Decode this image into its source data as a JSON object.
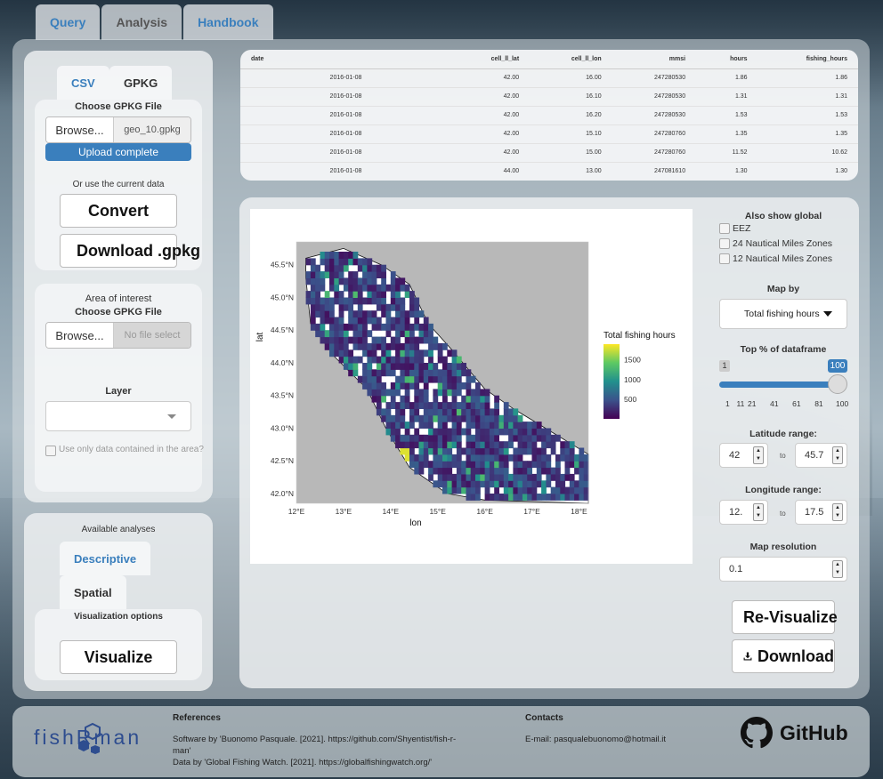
{
  "tabs": [
    {
      "label": "Query"
    },
    {
      "label": "Analysis"
    },
    {
      "label": "Handbook"
    }
  ],
  "upload": {
    "tab_csv": "CSV",
    "tab_gpkg": "GPKG",
    "choose_label": "Choose GPKG File",
    "browse_label": "Browse...",
    "file_name": "geo_10.gpkg",
    "progress_text": "Upload complete",
    "progress": 1.0,
    "current_data_label": "Or use the current data",
    "convert_label": "Convert",
    "download_label": "Download .gpkg"
  },
  "area": {
    "title": "Area of interest",
    "choose_label": "Choose GPKG File",
    "browse_label": "Browse...",
    "placeholder": "No file select",
    "layer_label": "Layer",
    "layer_value": "",
    "checkbox_label": "Use only data contained in the area?"
  },
  "analyses": {
    "title": "Available analyses",
    "descriptive": "Descriptive",
    "spatial": "Spatial",
    "viz_options": "Visualization options",
    "visualize_label": "Visualize"
  },
  "table": {
    "columns": [
      "date",
      "cell_ll_lat",
      "cell_ll_lon",
      "mmsi",
      "hours",
      "fishing_hours"
    ],
    "rows": [
      [
        "2016-01-08",
        "42.00",
        "16.00",
        "247280530",
        "1.86",
        "1.86"
      ],
      [
        "2016-01-08",
        "42.00",
        "16.10",
        "247280530",
        "1.31",
        "1.31"
      ],
      [
        "2016-01-08",
        "42.00",
        "16.20",
        "247280530",
        "1.53",
        "1.53"
      ],
      [
        "2016-01-08",
        "42.00",
        "15.10",
        "247280760",
        "1.35",
        "1.35"
      ],
      [
        "2016-01-08",
        "42.00",
        "15.00",
        "247280760",
        "11.52",
        "10.62"
      ],
      [
        "2016-01-08",
        "44.00",
        "13.00",
        "247081610",
        "1.30",
        "1.30"
      ]
    ]
  },
  "controls": {
    "global_title": "Also show global",
    "eez": "EEZ",
    "nm24": "24 Nautical Miles Zones",
    "nm12": "12 Nautical Miles Zones",
    "map_by_label": "Map by",
    "map_by_value": "Total fishing hours",
    "top_pct_label": "Top % of dataframe",
    "top_pct_min": "1",
    "top_pct_max": "100",
    "top_pct_ticks": [
      "1",
      "11",
      "21",
      "41",
      "61",
      "81",
      "100"
    ],
    "lat_label": "Latitude range:",
    "lat_from": "42",
    "lat_to": "45.7",
    "lon_label": "Longitude range:",
    "lon_from": "12.",
    "lon_to": "17.5",
    "to_text": "to",
    "res_label": "Map resolution",
    "res_value": "0.1",
    "revisualize_label": "Re-Visualize",
    "download_label": "Download"
  },
  "chart_data": {
    "type": "heatmap",
    "xlabel": "lon",
    "ylabel": "lat",
    "x_ticks": [
      "12°E",
      "13°E",
      "14°E",
      "15°E",
      "16°E",
      "17°E",
      "18°E"
    ],
    "y_ticks": [
      "42.0°N",
      "42.5°N",
      "43.0°N",
      "43.5°N",
      "44.0°N",
      "44.5°N",
      "45.0°N",
      "45.5°N"
    ],
    "xlim": [
      12,
      18.2
    ],
    "ylim": [
      41.85,
      45.85
    ],
    "legend_title": "Total fishing hours",
    "legend_ticks": [
      "1500",
      "1000",
      "500"
    ],
    "legend_range": [
      0,
      1900
    ],
    "colorscale": [
      "#440154",
      "#3b528b",
      "#21908d",
      "#5dc963",
      "#fde725"
    ]
  },
  "footer": {
    "logo_text": "fishRman",
    "refs_title": "References",
    "refs_line1": "Software by 'Buonomo Pasquale. [2021]. https://github.com/Shyentist/fish-r-",
    "refs_line2": "man'",
    "refs_line3": "Data by 'Global Fishing Watch. [2021]. https://globalfishingwatch.org/'",
    "contacts_title": "Contacts",
    "email": "E-mail: pasqualebuonomo@hotmail.it",
    "github_label": "GitHub"
  }
}
